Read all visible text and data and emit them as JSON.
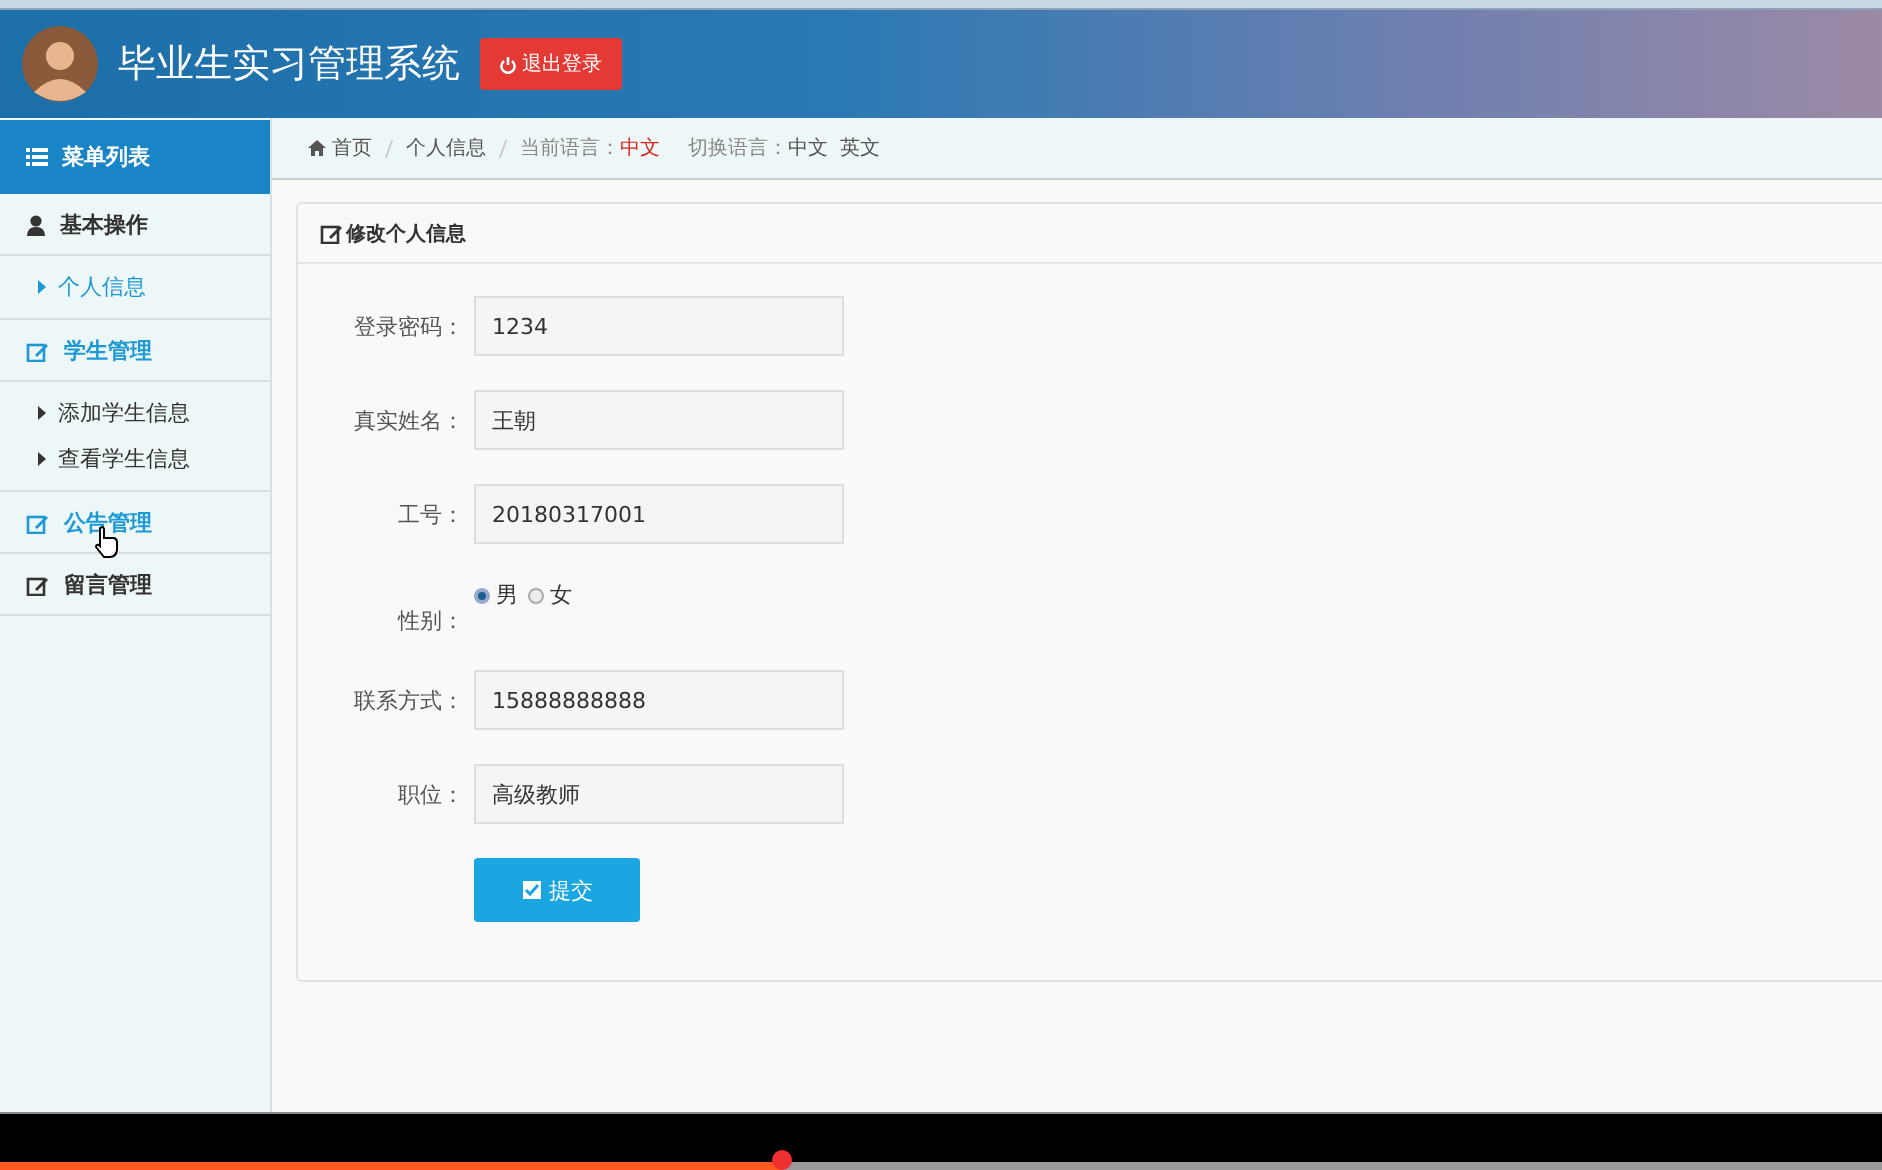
{
  "header": {
    "title": "毕业生实习管理系统",
    "logout_button": "退出登录"
  },
  "sidebar": {
    "title": "菜单列表",
    "items": [
      {
        "label": "基本操作",
        "kind": "user",
        "highlighted": false,
        "children": [
          {
            "label": "个人信息",
            "selected": true
          }
        ]
      },
      {
        "label": "学生管理",
        "kind": "edit",
        "highlighted": true,
        "children": [
          {
            "label": "添加学生信息",
            "selected": false
          },
          {
            "label": "查看学生信息",
            "selected": false
          }
        ]
      },
      {
        "label": "公告管理",
        "kind": "edit",
        "highlighted": true
      },
      {
        "label": "留言管理",
        "kind": "edit",
        "highlighted": false
      }
    ]
  },
  "breadcrumb": {
    "items": [
      "首页",
      "个人信息"
    ],
    "current_language_label": "当前语言：",
    "current_language": "中文",
    "switch_label": "切换语言：",
    "languages": [
      "中文",
      "英文"
    ]
  },
  "form": {
    "title": "修改个人信息",
    "fields": [
      {
        "label": "登录密码：",
        "kind": "text",
        "value": "1234"
      },
      {
        "label": "真实姓名：",
        "kind": "text",
        "value": "王朝"
      },
      {
        "label": "工号：",
        "kind": "text",
        "value": "20180317001"
      },
      {
        "label": "性别：",
        "kind": "radio",
        "options": [
          {
            "label": "男",
            "selected": true
          },
          {
            "label": "女",
            "selected": false
          }
        ]
      },
      {
        "label": "联系方式：",
        "kind": "text",
        "value": "15888888888"
      },
      {
        "label": "职位：",
        "kind": "text",
        "value": "高级教师"
      }
    ],
    "submit": "提交"
  },
  "video_bar": {
    "level": 0.415
  }
}
